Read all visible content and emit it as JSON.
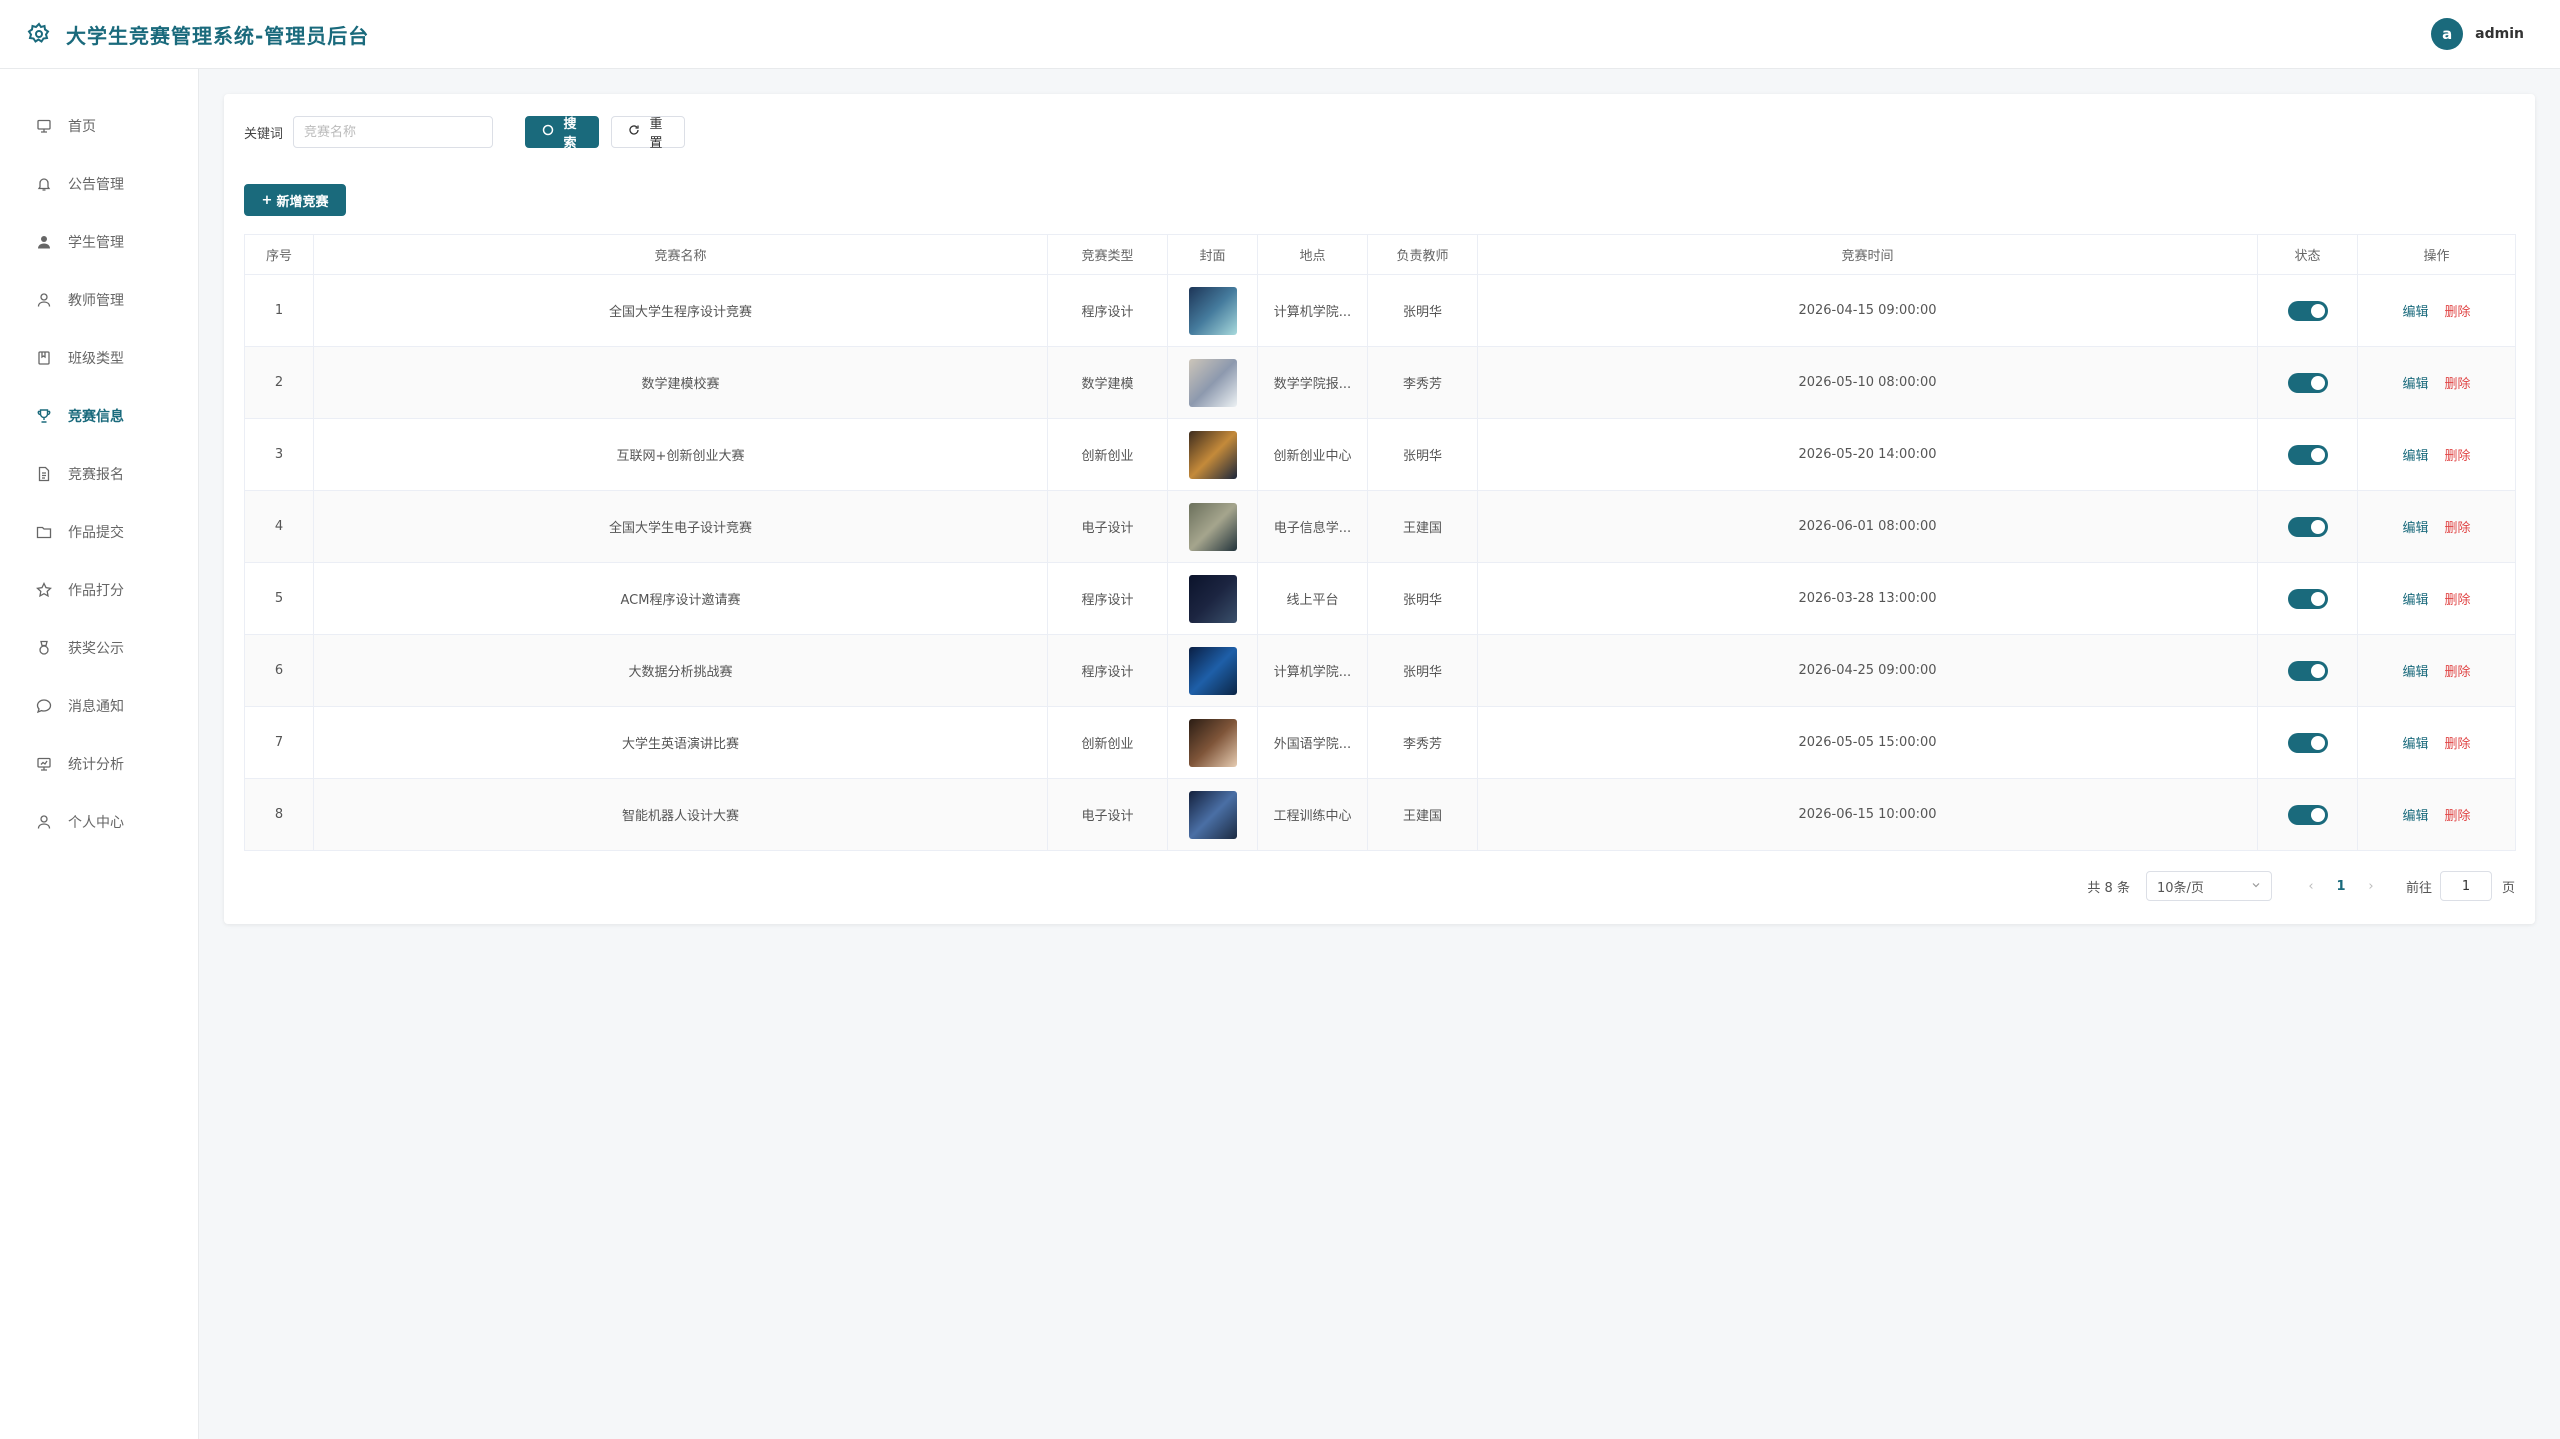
{
  "header": {
    "title": "大学生竞赛管理系统-管理员后台",
    "avatar_letter": "a",
    "username": "admin"
  },
  "sidebar": {
    "items": [
      {
        "label": "首页",
        "icon": "monitor-icon"
      },
      {
        "label": "公告管理",
        "icon": "bell-icon"
      },
      {
        "label": "学生管理",
        "icon": "user-filled-icon"
      },
      {
        "label": "教师管理",
        "icon": "user-icon"
      },
      {
        "label": "班级类型",
        "icon": "notebook-icon"
      },
      {
        "label": "竞赛信息",
        "icon": "trophy-icon"
      },
      {
        "label": "竞赛报名",
        "icon": "document-icon"
      },
      {
        "label": "作品提交",
        "icon": "folder-icon"
      },
      {
        "label": "作品打分",
        "icon": "star-icon"
      },
      {
        "label": "获奖公示",
        "icon": "medal-icon"
      },
      {
        "label": "消息通知",
        "icon": "chat-icon"
      },
      {
        "label": "统计分析",
        "icon": "chart-icon"
      },
      {
        "label": "个人中心",
        "icon": "user-icon"
      }
    ],
    "active_index": 5
  },
  "search": {
    "label": "关键词",
    "placeholder": "竞赛名称",
    "search_label": "搜索",
    "reset_label": "重置"
  },
  "toolbar": {
    "add_label": "新增竞赛"
  },
  "table": {
    "columns": [
      "序号",
      "竞赛名称",
      "竞赛类型",
      "封面",
      "地点",
      "负责教师",
      "竞赛时间",
      "状态",
      "操作"
    ],
    "edit_label": "编辑",
    "delete_label": "删除",
    "rows": [
      {
        "no": "1",
        "name": "全国大学生程序设计竞赛",
        "type": "程序设计",
        "location": "计算机学院...",
        "teacher": "张明华",
        "time": "2026-04-15 09:00:00",
        "status": true
      },
      {
        "no": "2",
        "name": "数学建模校赛",
        "type": "数学建模",
        "location": "数学学院报...",
        "teacher": "李秀芳",
        "time": "2026-05-10 08:00:00",
        "status": true
      },
      {
        "no": "3",
        "name": "互联网+创新创业大赛",
        "type": "创新创业",
        "location": "创新创业中心",
        "teacher": "张明华",
        "time": "2026-05-20 14:00:00",
        "status": true
      },
      {
        "no": "4",
        "name": "全国大学生电子设计竞赛",
        "type": "电子设计",
        "location": "电子信息学...",
        "teacher": "王建国",
        "time": "2026-06-01 08:00:00",
        "status": true
      },
      {
        "no": "5",
        "name": "ACM程序设计邀请赛",
        "type": "程序设计",
        "location": "线上平台",
        "teacher": "张明华",
        "time": "2026-03-28 13:00:00",
        "status": true
      },
      {
        "no": "6",
        "name": "大数据分析挑战赛",
        "type": "程序设计",
        "location": "计算机学院...",
        "teacher": "张明华",
        "time": "2026-04-25 09:00:00",
        "status": true
      },
      {
        "no": "7",
        "name": "大学生英语演讲比赛",
        "type": "创新创业",
        "location": "外国语学院...",
        "teacher": "李秀芳",
        "time": "2026-05-05 15:00:00",
        "status": true
      },
      {
        "no": "8",
        "name": "智能机器人设计大赛",
        "type": "电子设计",
        "location": "工程训练中心",
        "teacher": "王建国",
        "time": "2026-06-15 10:00:00",
        "status": true
      }
    ]
  },
  "pagination": {
    "total_text": "共 8 条",
    "page_size": "10条/页",
    "current_page": "1",
    "goto_label": "前往",
    "goto_value": "1",
    "page_unit": "页"
  },
  "colors": {
    "primary": "#1a6a7c",
    "danger": "#e04545"
  }
}
